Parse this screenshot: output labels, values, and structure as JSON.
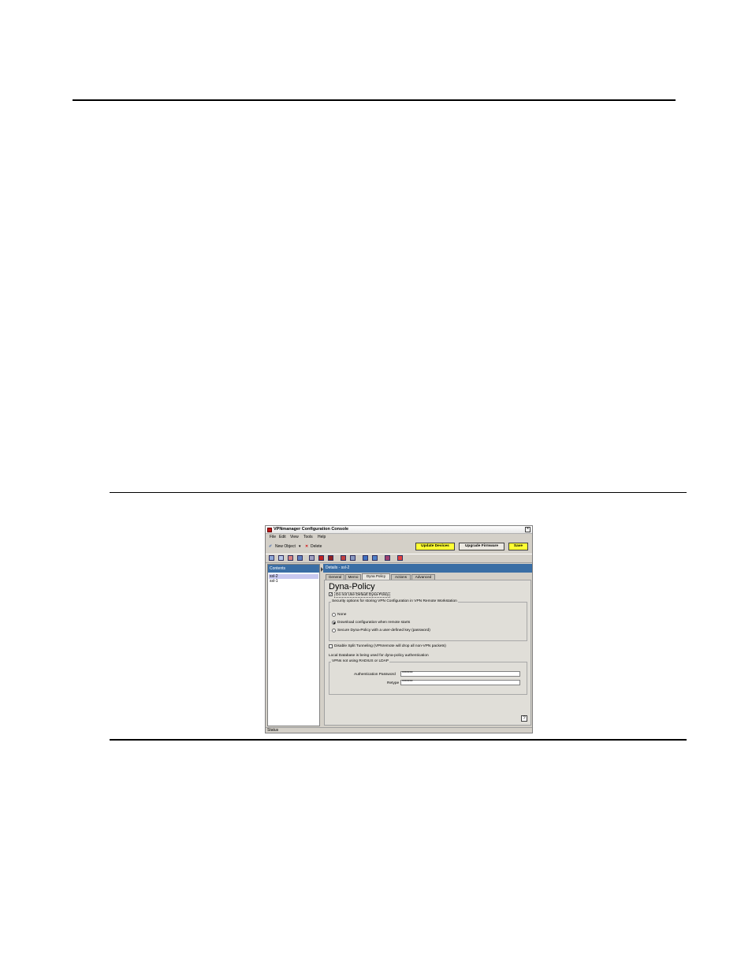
{
  "window": {
    "title": "VPNmanager Configuration Console",
    "close_glyph": "×"
  },
  "menu": [
    "File",
    "Edit",
    "View",
    "Tools",
    "Help"
  ],
  "actions": {
    "new_object": "New Object",
    "delete": "Delete",
    "update_devices": "Update Devices",
    "upgrade_firmware": "Upgrade Firmware",
    "save": "Save"
  },
  "toolbar_icons": [
    "device-icon",
    "group-icon",
    "user-icon",
    "vpn-icon",
    "key-icon",
    "policy-icon",
    "red-policy-icon",
    "qos-icon",
    "network-icon",
    "export-icon",
    "import-icon",
    "report-icon",
    "help-book-icon"
  ],
  "left_pane": {
    "header": "Contents",
    "items": [
      "ssl-2",
      "ssl-1"
    ]
  },
  "right_pane": {
    "header": "Details - ssl-2",
    "tabs": [
      "General",
      "Memo",
      "Dyna Policy",
      "Actions",
      "Advanced"
    ],
    "heading": "Dyna-Policy",
    "use_default_label": "Do not Use Default Dyna-Policy",
    "security_group_title": "Security options for storing VPN Configuration in VPN Remote Workstation",
    "options": [
      "None",
      "Download configuration when remote starts",
      "Secure Dyna-Policy with a user-defined key (password)"
    ],
    "split_tunnel_label": "Disable Split Tunneling (VPNremote will drop all non-VPN packets)",
    "local_db_note": "Local Database is being used for dyna-policy authentication",
    "radius_group_title": "VPNs not using RADIUS or LDAP",
    "auth_password_label": "Authentication Password",
    "auth_password_value": "*******",
    "retype_label": "Retype",
    "retype_value": "*******",
    "help_glyph": "?"
  },
  "status": "Status",
  "colors": {
    "accent": "#3a6ea5",
    "highlight_button": "#ffff33",
    "window_bg": "#d4d0c8"
  }
}
